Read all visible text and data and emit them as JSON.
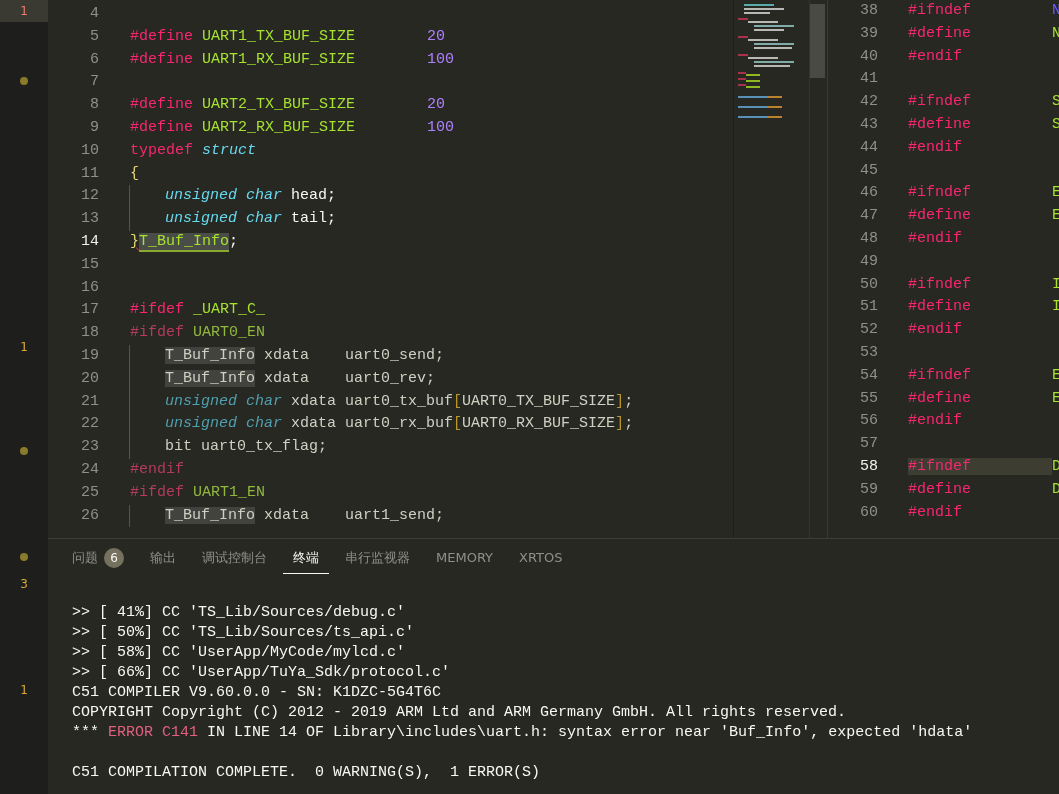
{
  "activity_markers": [
    {
      "kind": "count",
      "text": "1",
      "selected": true
    },
    {
      "kind": "dot",
      "selected": false
    },
    {
      "kind": "count",
      "text": "1",
      "selected": false
    },
    {
      "kind": "dot",
      "selected": false
    },
    {
      "kind": "dot",
      "selected": false
    },
    {
      "kind": "count",
      "text": "3",
      "selected": false
    },
    {
      "kind": "count",
      "text": "1",
      "selected": false
    }
  ],
  "editor": {
    "lines": [
      {
        "n": "4",
        "current": false,
        "indented": false
      },
      {
        "n": "5",
        "current": false,
        "indented": false,
        "tokens": [
          {
            "text": "#define",
            "kind": "directive"
          },
          {
            "text": "UART1_TX_BUF_SIZE",
            "kind": "macro"
          },
          {
            "text": "20",
            "kind": "number"
          }
        ]
      },
      {
        "n": "6",
        "current": false,
        "indented": false,
        "tokens": [
          {
            "text": "#define",
            "kind": "directive"
          },
          {
            "text": "UART1_RX_BUF_SIZE",
            "kind": "macro"
          },
          {
            "text": "100",
            "kind": "number"
          }
        ]
      },
      {
        "n": "7",
        "current": false,
        "indented": false
      },
      {
        "n": "8",
        "current": false,
        "indented": false,
        "tokens": [
          {
            "text": "#define",
            "kind": "directive"
          },
          {
            "text": "UART2_TX_BUF_SIZE",
            "kind": "macro"
          },
          {
            "text": "20",
            "kind": "number"
          }
        ]
      },
      {
        "n": "9",
        "current": false,
        "indented": false,
        "tokens": [
          {
            "text": "#define",
            "kind": "directive"
          },
          {
            "text": "UART2_RX_BUF_SIZE",
            "kind": "macro"
          },
          {
            "text": "100",
            "kind": "number"
          }
        ]
      },
      {
        "n": "10",
        "current": false,
        "indented": false,
        "tokens": [
          {
            "text": "typedef",
            "kind": "keyword"
          },
          {
            "text": "struct",
            "kind": "type"
          }
        ]
      },
      {
        "n": "11",
        "current": false,
        "indented": false,
        "tokens": [
          {
            "text": "{",
            "kind": "bracket"
          }
        ]
      },
      {
        "n": "12",
        "current": false,
        "indented": true,
        "tokens": [
          {
            "text": "unsigned char",
            "kind": "type"
          },
          {
            "text": "head;",
            "kind": "plain"
          }
        ]
      },
      {
        "n": "13",
        "current": false,
        "indented": true,
        "tokens": [
          {
            "text": "unsigned char",
            "kind": "type"
          },
          {
            "text": "tail;",
            "kind": "plain"
          }
        ]
      },
      {
        "n": "14",
        "current": true,
        "indented": false,
        "tokens": [
          {
            "text": "}",
            "kind": "bracket-error"
          },
          {
            "text": "T_Buf_Info",
            "kind": "selection"
          },
          {
            "text": ";",
            "kind": "plain"
          }
        ]
      },
      {
        "n": "15",
        "current": false,
        "indented": false
      },
      {
        "n": "16",
        "current": false,
        "indented": false
      },
      {
        "n": "17",
        "current": false,
        "indented": false,
        "tokens": [
          {
            "text": "#ifdef",
            "kind": "directive"
          },
          {
            "text": "_UART_C_",
            "kind": "macro"
          }
        ]
      },
      {
        "n": "18",
        "current": false,
        "indented": false,
        "tokens": [
          {
            "text": "#ifdef",
            "kind": "directive-dim"
          },
          {
            "text": "UART0_EN",
            "kind": "macro-dim"
          }
        ]
      },
      {
        "n": "19",
        "current": false,
        "indented": true,
        "tokens": [
          {
            "text": "T_Buf_Info",
            "kind": "match"
          },
          {
            "text": "xdata",
            "kind": "plain-dim"
          },
          {
            "text": "uart0_send;",
            "kind": "plain-dim"
          }
        ]
      },
      {
        "n": "20",
        "current": false,
        "indented": true,
        "tokens": [
          {
            "text": "T_Buf_Info",
            "kind": "match"
          },
          {
            "text": "xdata",
            "kind": "plain-dim"
          },
          {
            "text": "uart0_rev;",
            "kind": "plain-dim"
          }
        ]
      },
      {
        "n": "21",
        "current": false,
        "indented": true,
        "tokens": [
          {
            "text": "unsigned char",
            "kind": "type-dim"
          },
          {
            "text": "xdata uart0_tx_buf",
            "kind": "plain-dim"
          },
          {
            "text": "[",
            "kind": "bracket-dim"
          },
          {
            "text": "UART0_TX_BUF_SIZE",
            "kind": "plain-dim"
          },
          {
            "text": "]",
            "kind": "bracket-dim"
          },
          {
            "text": ";",
            "kind": "plain-dim"
          }
        ]
      },
      {
        "n": "22",
        "current": false,
        "indented": true,
        "tokens": [
          {
            "text": "unsigned char",
            "kind": "type-dim"
          },
          {
            "text": "xdata uart0_rx_buf",
            "kind": "plain-dim"
          },
          {
            "text": "[",
            "kind": "bracket-dim"
          },
          {
            "text": "UART0_RX_BUF_SIZE",
            "kind": "plain-dim"
          },
          {
            "text": "]",
            "kind": "bracket-dim"
          },
          {
            "text": ";",
            "kind": "plain-dim"
          }
        ]
      },
      {
        "n": "23",
        "current": false,
        "indented": true,
        "tokens": [
          {
            "text": "bit uart0_tx_flag;",
            "kind": "plain-dim"
          }
        ]
      },
      {
        "n": "24",
        "current": false,
        "indented": false,
        "tokens": [
          {
            "text": "#endif",
            "kind": "directive-dim"
          }
        ]
      },
      {
        "n": "25",
        "current": false,
        "indented": false,
        "tokens": [
          {
            "text": "#ifdef",
            "kind": "directive-dim"
          },
          {
            "text": "UART1_EN",
            "kind": "macro-dim"
          }
        ]
      },
      {
        "n": "26",
        "current": false,
        "indented": true,
        "tokens": [
          {
            "text": "T_Buf_Info",
            "kind": "match"
          },
          {
            "text": "xdata",
            "kind": "plain-dim"
          },
          {
            "text": "uart1_send;",
            "kind": "plain-dim"
          }
        ]
      }
    ]
  },
  "side_editor": {
    "lines": [
      {
        "n": "38",
        "current": false,
        "tokens": [
          {
            "text": "#ifndef",
            "kind": "directive"
          },
          {
            "text": "N",
            "kind": "constant"
          }
        ]
      },
      {
        "n": "39",
        "current": false,
        "tokens": [
          {
            "text": "#define",
            "kind": "directive"
          },
          {
            "text": "N",
            "kind": "macro"
          }
        ]
      },
      {
        "n": "40",
        "current": false,
        "tokens": [
          {
            "text": "#endif",
            "kind": "directive"
          }
        ]
      },
      {
        "n": "41",
        "current": false
      },
      {
        "n": "42",
        "current": false,
        "tokens": [
          {
            "text": "#ifndef",
            "kind": "directive"
          },
          {
            "text": "S",
            "kind": "macro"
          }
        ]
      },
      {
        "n": "43",
        "current": false,
        "tokens": [
          {
            "text": "#define",
            "kind": "directive"
          },
          {
            "text": "S",
            "kind": "macro"
          }
        ]
      },
      {
        "n": "44",
        "current": false,
        "tokens": [
          {
            "text": "#endif",
            "kind": "directive"
          }
        ]
      },
      {
        "n": "45",
        "current": false
      },
      {
        "n": "46",
        "current": false,
        "tokens": [
          {
            "text": "#ifndef",
            "kind": "directive"
          },
          {
            "text": "E",
            "kind": "macro"
          }
        ]
      },
      {
        "n": "47",
        "current": false,
        "tokens": [
          {
            "text": "#define",
            "kind": "directive"
          },
          {
            "text": "E",
            "kind": "macro"
          }
        ]
      },
      {
        "n": "48",
        "current": false,
        "tokens": [
          {
            "text": "#endif",
            "kind": "directive"
          }
        ]
      },
      {
        "n": "49",
        "current": false
      },
      {
        "n": "50",
        "current": false,
        "tokens": [
          {
            "text": "#ifndef",
            "kind": "directive"
          },
          {
            "text": "I",
            "kind": "macro"
          }
        ]
      },
      {
        "n": "51",
        "current": false,
        "tokens": [
          {
            "text": "#define",
            "kind": "directive"
          },
          {
            "text": "I",
            "kind": "macro"
          }
        ]
      },
      {
        "n": "52",
        "current": false,
        "tokens": [
          {
            "text": "#endif",
            "kind": "directive"
          }
        ]
      },
      {
        "n": "53",
        "current": false
      },
      {
        "n": "54",
        "current": false,
        "tokens": [
          {
            "text": "#ifndef",
            "kind": "directive"
          },
          {
            "text": "E",
            "kind": "macro"
          }
        ]
      },
      {
        "n": "55",
        "current": false,
        "tokens": [
          {
            "text": "#define",
            "kind": "directive"
          },
          {
            "text": "E",
            "kind": "macro"
          }
        ]
      },
      {
        "n": "56",
        "current": false,
        "tokens": [
          {
            "text": "#endif",
            "kind": "directive"
          }
        ]
      },
      {
        "n": "57",
        "current": false
      },
      {
        "n": "58",
        "current": true,
        "tokens": [
          {
            "text": "#ifndef",
            "kind": "directive"
          },
          {
            "text": "D",
            "kind": "macro"
          }
        ]
      },
      {
        "n": "59",
        "current": false,
        "tokens": [
          {
            "text": "#define",
            "kind": "directive"
          },
          {
            "text": "D",
            "kind": "macro"
          }
        ]
      },
      {
        "n": "60",
        "current": false,
        "tokens": [
          {
            "text": "#endif",
            "kind": "directive"
          }
        ]
      }
    ]
  },
  "panel": {
    "tabs": [
      {
        "label": "问题",
        "badge": "6",
        "selected": false
      },
      {
        "label": "输出",
        "selected": false
      },
      {
        "label": "调试控制台",
        "selected": false
      },
      {
        "label": "终端",
        "selected": true
      },
      {
        "label": "串行监视器",
        "selected": false
      },
      {
        "label": "MEMORY",
        "selected": false
      },
      {
        "label": "XRTOS",
        "selected": false
      }
    ],
    "terminal": [
      {
        "lines": [
          {
            "tokens": [
              {
                "text": ">> [ 41%] CC 'TS_Lib/Sources/debug.c'",
                "kind": "plain"
              }
            ]
          },
          {
            "tokens": [
              {
                "text": ">> [ 50%] CC 'TS_Lib/Sources/ts_api.c'",
                "kind": "plain"
              }
            ]
          },
          {
            "tokens": [
              {
                "text": ">> [ 58%] CC 'UserApp/MyCode/mylcd.c'",
                "kind": "plain"
              }
            ]
          },
          {
            "tokens": [
              {
                "text": ">> [ 66%] CC 'UserApp/TuYa_Sdk/protocol.c'",
                "kind": "plain"
              }
            ]
          },
          {
            "tokens": [
              {
                "text": "C51 COMPILER V9.60.0.0 - SN: K1DZC-5G4T6C",
                "kind": "plain"
              }
            ]
          },
          {
            "tokens": [
              {
                "text": "COPYRIGHT Copyright (C) 2012 - 2019 ARM Ltd and ARM Germany GmbH. All rights reserved.",
                "kind": "plain"
              }
            ]
          },
          {
            "tokens": [
              {
                "text": "***",
                "kind": "plain"
              },
              {
                "text": "ERROR C141",
                "kind": "error"
              },
              {
                "text": "IN LINE 14 OF Library\\includes\\uart.h: syntax error near 'Buf_Info', expected 'hdata'",
                "kind": "plain"
              }
            ]
          }
        ]
      },
      {
        "lines": [
          {
            "tokens": [
              {
                "text": "C51 COMPILATION COMPLETE.  0 WARNING(S),  1 ERROR(S)",
                "kind": "plain"
              }
            ]
          }
        ]
      }
    ]
  }
}
